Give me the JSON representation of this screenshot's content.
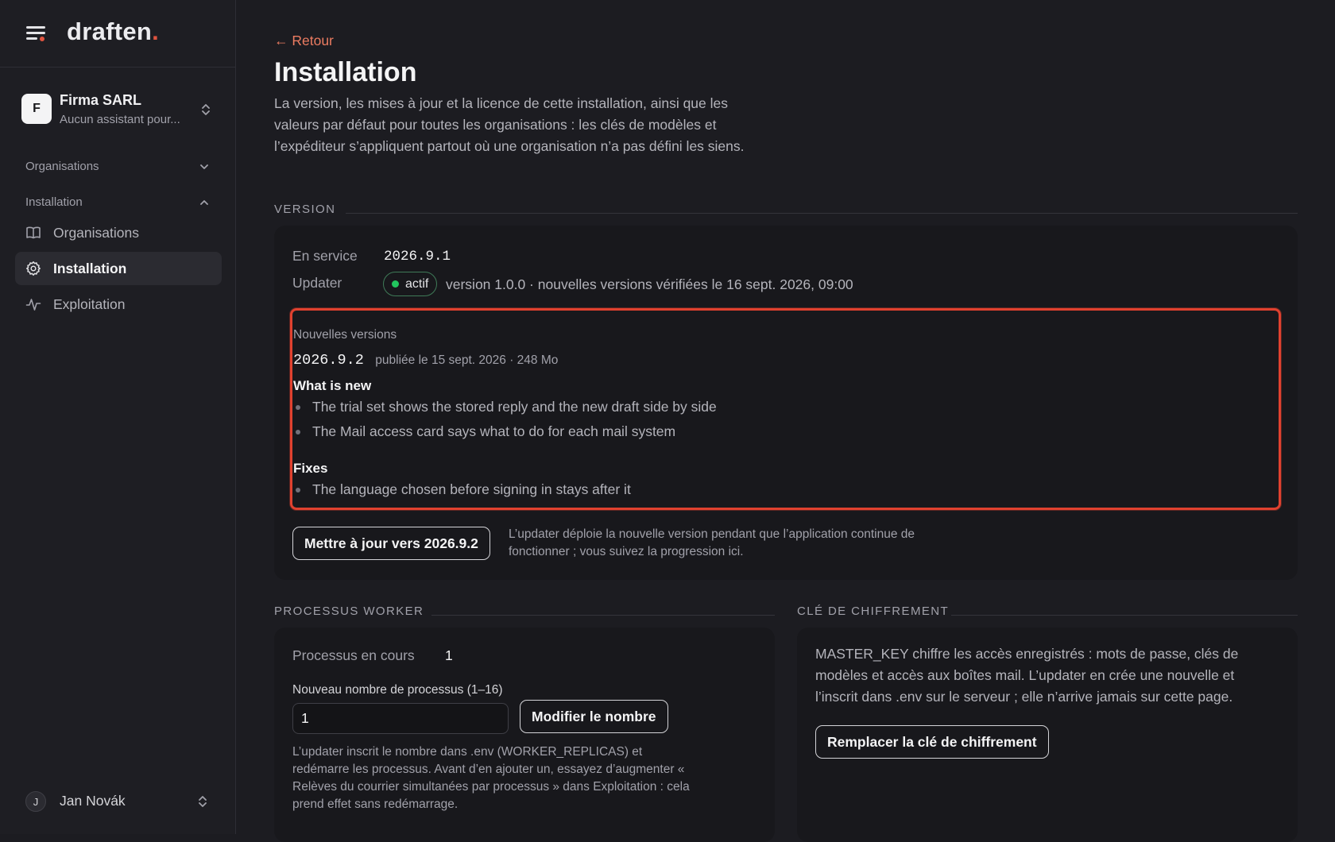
{
  "brand": {
    "name": "draften",
    "dot": "."
  },
  "sidebar": {
    "org": {
      "initial": "F",
      "name": "Firma SARL",
      "subtitle": "Aucun assistant pour..."
    },
    "groups": [
      {
        "label": "Organisations",
        "expanded": false
      },
      {
        "label": "Installation",
        "expanded": true
      }
    ],
    "items": [
      {
        "label": "Organisations",
        "icon": "book-icon",
        "active": false
      },
      {
        "label": "Installation",
        "icon": "gear-icon",
        "active": true
      },
      {
        "label": "Exploitation",
        "icon": "activity-icon",
        "active": false
      }
    ],
    "user": {
      "initial": "J",
      "name": "Jan Novák"
    }
  },
  "page": {
    "back": "← Retour",
    "title": "Installation",
    "description": "La version, les mises à jour et la licence de cette installation, ainsi que les valeurs par défaut pour toutes les organisations : les clés de modèles et l’expéditeur s’appliquent partout où une organisation n’a pas défini les siens."
  },
  "version": {
    "heading": "VERSION",
    "in_service_label": "En service",
    "in_service_value": "2026.9.1",
    "updater_label": "Updater",
    "updater_status": "actif",
    "updater_info": "version 1.0.0 · nouvelles versions vérifiées le 16 sept. 2026, 09:00",
    "new_versions_label": "Nouvelles versions",
    "release": {
      "version": "2026.9.2",
      "meta": "publiée le 15 sept. 2026 · 248 Mo",
      "sections": [
        {
          "title": "What is new",
          "items": [
            "The trial set shows the stored reply and the new draft side by side",
            "The Mail access card says what to do for each mail system"
          ]
        },
        {
          "title": "Fixes",
          "items": [
            "The language chosen before signing in stays after it"
          ]
        }
      ]
    },
    "update_button": "Mettre à jour vers 2026.9.2",
    "update_help": "L’updater déploie la nouvelle version pendant que l’application continue de fonctionner ; vous suivez la progression ici."
  },
  "worker": {
    "heading": "PROCESSUS WORKER",
    "running_label": "Processus en cours",
    "running_value": "1",
    "new_count_label": "Nouveau nombre de processus (1–16)",
    "new_count_value": "1",
    "modify_button": "Modifier le nombre",
    "help": "L’updater inscrit le nombre dans .env (WORKER_REPLICAS) et redémarre les processus. Avant d’en ajouter un, essayez d’augmenter « Relèves du courrier simultanées par processus » dans Exploitation : cela prend effet sans redémarrage."
  },
  "encryption": {
    "heading": "CLÉ DE CHIFFREMENT",
    "description": "MASTER_KEY chiffre les accès enregistrés : mots de passe, clés de modèles et accès aux boîtes mail. L’updater en crée une nouvelle et l’inscrit dans .env sur le serveur ; elle n’arrive jamais sur cette page.",
    "replace_button": "Remplacer la clé de chiffrement"
  },
  "colors": {
    "accent": "#ec7c61",
    "highlight": "#e0412f",
    "status_ok": "#22c55e"
  }
}
